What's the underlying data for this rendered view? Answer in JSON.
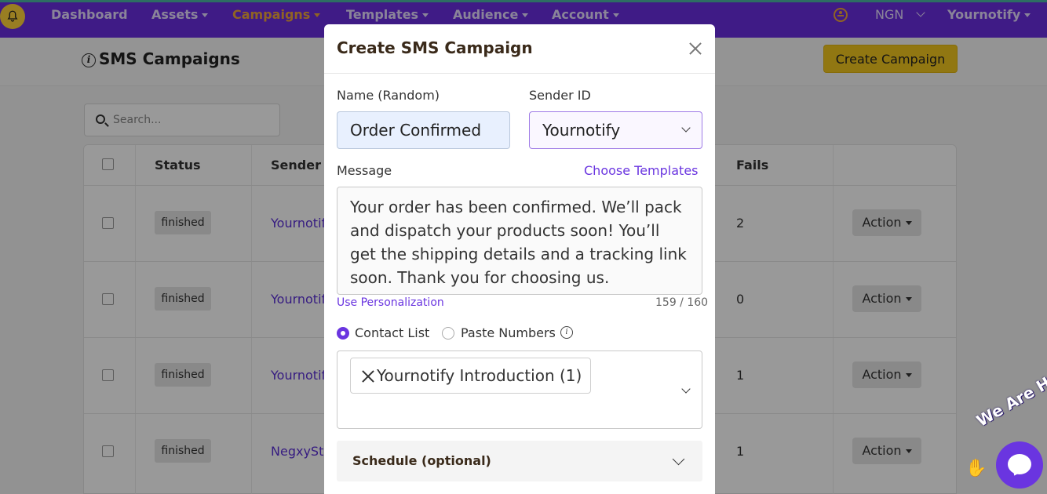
{
  "nav": {
    "items": [
      {
        "label": "Dashboard",
        "dropdown": false,
        "active": false
      },
      {
        "label": "Assets",
        "dropdown": true,
        "active": false
      },
      {
        "label": "Campaigns",
        "dropdown": true,
        "active": true
      },
      {
        "label": "Templates",
        "dropdown": true,
        "active": false
      },
      {
        "label": "Audience",
        "dropdown": true,
        "active": false
      },
      {
        "label": "Account",
        "dropdown": true,
        "active": false
      }
    ],
    "currency": "NGN",
    "user": "Yournotify",
    "colors": {
      "bar": "#6a2ee0",
      "active": "#f1a63b",
      "logo": "#ffd23a"
    }
  },
  "page": {
    "title": "SMS Campaigns",
    "create_button": "Create Campaign",
    "search_placeholder": "Search..."
  },
  "table": {
    "headers": {
      "status": "Status",
      "sender": "Sender ID",
      "fails": "Fails"
    },
    "rows": [
      {
        "status": "finished",
        "sender": "Yournotify",
        "fails": "2",
        "action": "Action"
      },
      {
        "status": "finished",
        "sender": "Yournotify",
        "fails": "0",
        "action": "Action"
      },
      {
        "status": "finished",
        "sender": "Yournotify",
        "fails": "1",
        "action": "Action"
      },
      {
        "status": "finished",
        "sender": "NegxyStudio",
        "fails": "1",
        "action": "Action"
      }
    ]
  },
  "modal": {
    "title": "Create SMS Campaign",
    "name_label": "Name (Random)",
    "name_value": "Order Confirmed",
    "sender_label": "Sender ID",
    "sender_value": "Yournotify",
    "message_label": "Message",
    "choose_templates": "Choose Templates",
    "message_text": "Your order has been confirmed. We’ll pack and dispatch your products soon! You’ll get the shipping details and a tracking link soon. Thank you for choosing us.",
    "use_personalization": "Use Personalization",
    "char_count": "159 / 160",
    "option_contact_list": "Contact List",
    "option_paste_numbers": "Paste Numbers",
    "selected_list": "Yournotify Introduction (1)",
    "schedule_label": "Schedule  (optional)",
    "colors": {
      "accent": "#6a35e0"
    }
  },
  "chat": {
    "label": "We Are Here!"
  }
}
